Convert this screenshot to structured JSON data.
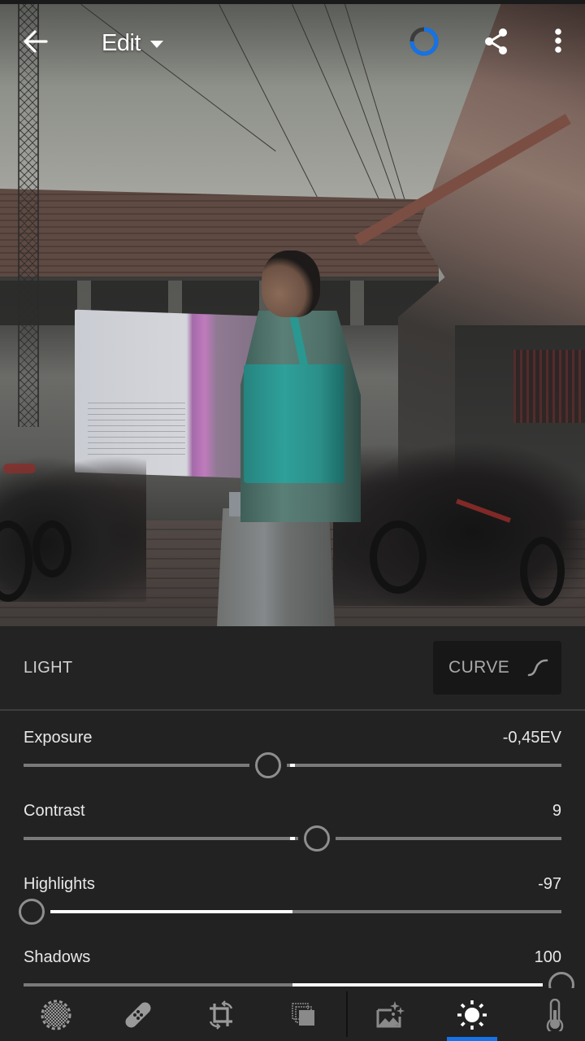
{
  "header": {
    "back_icon": "arrow-left-icon",
    "mode_label": "Edit",
    "mode_dropdown_icon": "caret-down-icon",
    "sync_progress": 0.75,
    "sync_progress_color": "#1473e6",
    "share_icon": "share-icon",
    "more_icon": "more-vertical-icon"
  },
  "panel": {
    "section_title": "LIGHT",
    "curve_button_label": "CURVE",
    "curve_icon": "curve-icon",
    "sliders": [
      {
        "label": "Exposure",
        "value": "-0,45EV",
        "position": 0.455,
        "fill_from": 0.5,
        "fill_to": 0.5
      },
      {
        "label": "Contrast",
        "value": "9",
        "position": 0.545,
        "fill_from": 0.5,
        "fill_to": 0.5
      },
      {
        "label": "Highlights",
        "value": "-97",
        "position": 0.015,
        "fill_from": 0.015,
        "fill_to": 0.5
      },
      {
        "label": "Shadows",
        "value": "100",
        "position": 1.0,
        "fill_from": 0.5,
        "fill_to": 1.0
      }
    ]
  },
  "toolbar": {
    "tools": [
      {
        "name": "selective",
        "icon": "selective-brush-icon",
        "active": false
      },
      {
        "name": "healing",
        "icon": "bandage-icon",
        "active": false
      },
      {
        "name": "crop",
        "icon": "crop-icon",
        "active": false
      },
      {
        "name": "presets",
        "icon": "presets-icon",
        "active": false
      },
      {
        "name": "auto",
        "icon": "auto-enhance-icon",
        "active": false
      },
      {
        "name": "light",
        "icon": "light-sun-icon",
        "active": true
      },
      {
        "name": "color",
        "icon": "thermometer-icon",
        "active": false
      }
    ],
    "active_color": "#1473e6"
  }
}
